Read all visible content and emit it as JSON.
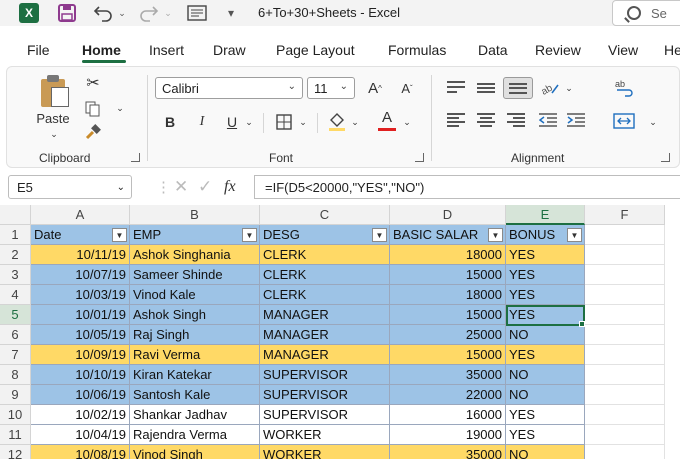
{
  "titlebar": {
    "title": "6+To+30+Sheets  -  Excel",
    "search_placeholder": "Se",
    "app_icon_letter": "X"
  },
  "tabs": [
    "File",
    "Home",
    "Insert",
    "Draw",
    "Page Layout",
    "Formulas",
    "Data",
    "Review",
    "View",
    "He"
  ],
  "active_tab": "Home",
  "ribbon": {
    "paste_label": "Paste",
    "font_name": "Calibri",
    "font_size": "11",
    "bold": "B",
    "italic": "I",
    "underline": "U",
    "groups": {
      "clipboard": "Clipboard",
      "font": "Font",
      "alignment": "Alignment"
    }
  },
  "formula_bar": {
    "name_box": "E5",
    "fx": "fx",
    "formula": "=IF(D5<20000,\"YES\",\"NO\")"
  },
  "colors": {
    "blue_fill": "#9dc3e6",
    "orange_fill": "#ffd966",
    "white_fill": "#ffffff",
    "accent": "#1d6f42"
  },
  "columns": [
    "A",
    "B",
    "C",
    "D",
    "E",
    "F"
  ],
  "selected_column": "E",
  "selected_row": "5",
  "headers": [
    "Date",
    "EMP",
    "DESG",
    "BASIC SALAR",
    "BONUS"
  ],
  "rows": [
    {
      "num": "2",
      "fill": "orange",
      "date": "10/11/19",
      "emp": "Ashok Singhania",
      "desg": "CLERK",
      "salary": "18000",
      "bonus": "YES"
    },
    {
      "num": "3",
      "fill": "blue",
      "date": "10/07/19",
      "emp": "Sameer Shinde",
      "desg": "CLERK",
      "salary": "15000",
      "bonus": "YES"
    },
    {
      "num": "4",
      "fill": "blue",
      "date": "10/03/19",
      "emp": "Vinod Kale",
      "desg": "CLERK",
      "salary": "18000",
      "bonus": "YES"
    },
    {
      "num": "5",
      "fill": "blue",
      "date": "10/01/19",
      "emp": "Ashok Singh",
      "desg": "MANAGER",
      "salary": "15000",
      "bonus": "YES"
    },
    {
      "num": "6",
      "fill": "blue",
      "date": "10/05/19",
      "emp": "Raj Singh",
      "desg": "MANAGER",
      "salary": "25000",
      "bonus": "NO"
    },
    {
      "num": "7",
      "fill": "orange",
      "date": "10/09/19",
      "emp": "Ravi Verma",
      "desg": "MANAGER",
      "salary": "15000",
      "bonus": "YES"
    },
    {
      "num": "8",
      "fill": "blue",
      "date": "10/10/19",
      "emp": "Kiran Katekar",
      "desg": "SUPERVISOR",
      "salary": "35000",
      "bonus": "NO"
    },
    {
      "num": "9",
      "fill": "blue",
      "date": "10/06/19",
      "emp": "Santosh Kale",
      "desg": "SUPERVISOR",
      "salary": "22000",
      "bonus": "NO"
    },
    {
      "num": "10",
      "fill": "white",
      "date": "10/02/19",
      "emp": "Shankar Jadhav",
      "desg": "SUPERVISOR",
      "salary": "16000",
      "bonus": "YES"
    },
    {
      "num": "11",
      "fill": "white",
      "date": "10/04/19",
      "emp": "Rajendra Verma",
      "desg": "WORKER",
      "salary": "19000",
      "bonus": "YES"
    },
    {
      "num": "12",
      "fill": "orange",
      "date": "10/08/19",
      "emp": "Vinod Singh",
      "desg": "WORKER",
      "salary": "35000",
      "bonus": "NO"
    }
  ]
}
